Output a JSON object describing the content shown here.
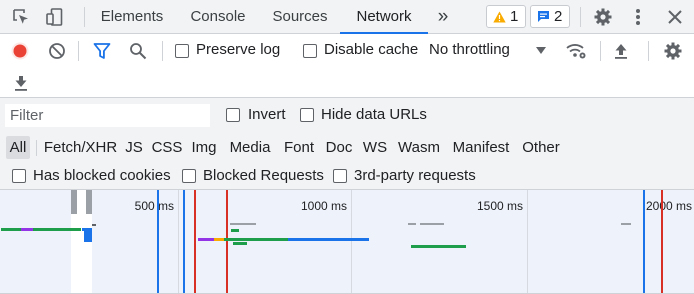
{
  "tabs": {
    "items": [
      {
        "label": "Elements"
      },
      {
        "label": "Console"
      },
      {
        "label": "Sources"
      },
      {
        "label": "Network",
        "active": true
      }
    ],
    "more_glyph": "»"
  },
  "badges": {
    "warnings": "1",
    "messages": "2"
  },
  "toolbar": {
    "preserve_log_label": "Preserve log",
    "disable_cache_label": "Disable cache",
    "throttling_value": "No throttling"
  },
  "filter": {
    "placeholder": "Filter",
    "invert_label": "Invert",
    "hide_data_urls_label": "Hide data URLs"
  },
  "resource_types": [
    {
      "label": "All",
      "active": true
    },
    {
      "label": "Fetch/XHR"
    },
    {
      "label": "JS"
    },
    {
      "label": "CSS"
    },
    {
      "label": "Img"
    },
    {
      "label": "Media"
    },
    {
      "label": "Font"
    },
    {
      "label": "Doc"
    },
    {
      "label": "WS"
    },
    {
      "label": "Wasm"
    },
    {
      "label": "Manifest"
    },
    {
      "label": "Other"
    }
  ],
  "blocked_filters": {
    "blocked_cookies_label": "Has blocked cookies",
    "blocked_requests_label": "Blocked Requests",
    "third_party_label": "3rd-party requests"
  },
  "overview": {
    "ticks": [
      "500 ms",
      "1000 ms",
      "1500 ms",
      "2000 ms"
    ]
  },
  "colors": {
    "accent": "#1a73e8",
    "record": "#ea4335",
    "warning": "#f9ab00",
    "bar_green": "#1e9e4b",
    "bar_blue": "#1a73e8",
    "bar_purple": "#9334e6",
    "dom_line": "#1a73e8",
    "load_line": "#d93025"
  }
}
